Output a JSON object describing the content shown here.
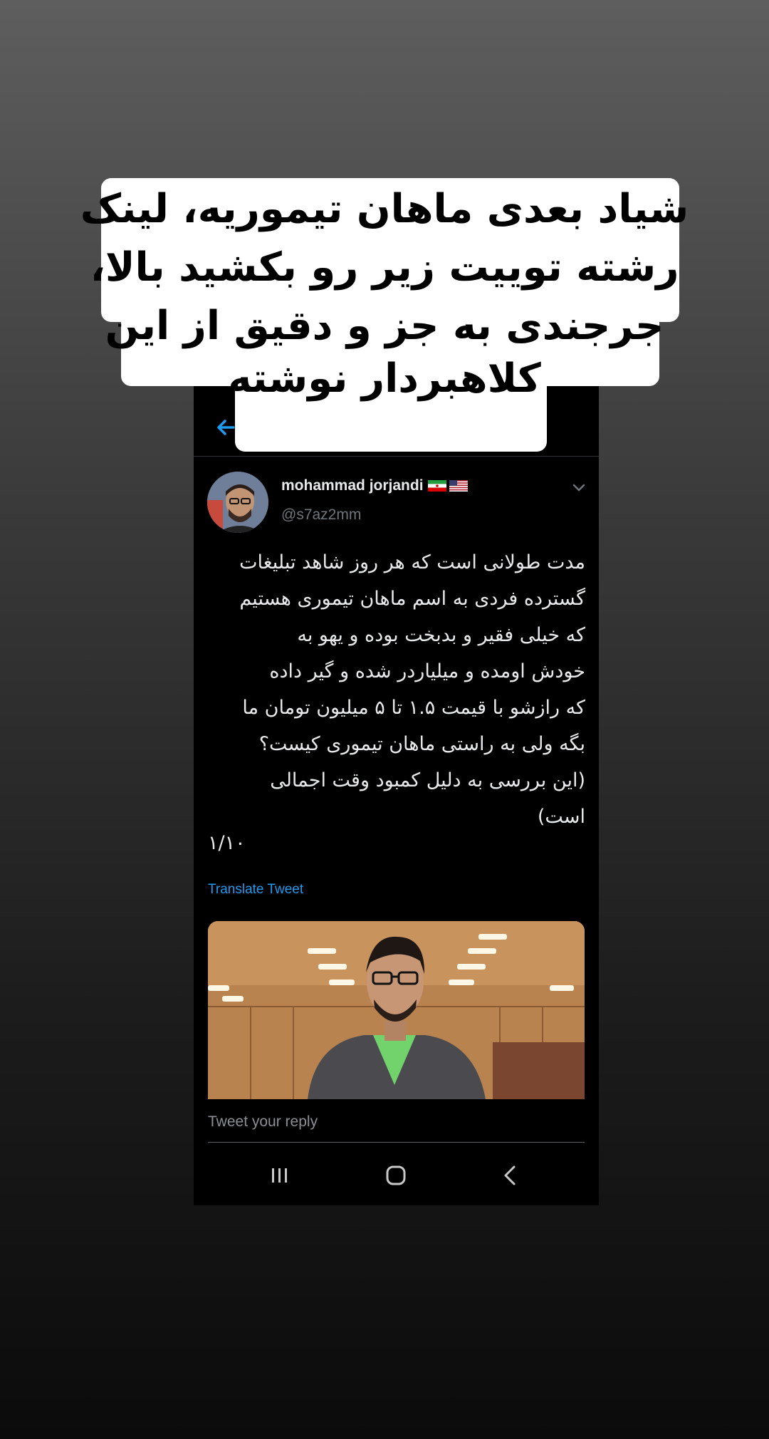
{
  "caption": {
    "lines": [
      "شیاد بعدی ماهان تیموریه، لینک",
      "رشته توییت زیر رو بکشید بالا،",
      "جرجندی به جز و دقیق از این",
      "کلاهبردار نوشته"
    ],
    "background_color": "#ffffff",
    "text_color": "#000000"
  },
  "tweet": {
    "author_name": "mohammad jorjandi",
    "author_flags": [
      "iran-flag-icon",
      "us-flag-icon"
    ],
    "handle": "@s7az2mm",
    "body_lines": [
      "مدت طولانی است که هر روز شاهد تبلیغات",
      "گسترده فردی به اسم ماهان تیموری هستیم",
      "که خیلی فقیر و بدبخت بوده و یهو به",
      "خودش اومده و میلیاردر شده و گیر داده",
      "که رازشو با قیمت ۱.۵ تا ۵ میلیون تومان ما",
      "بگه ولی به راستی ماهان تیموری کیست؟",
      "(این بررسی به دلیل کمبود وقت اجمالی",
      "است)"
    ],
    "thread_count": "۱/۱۰",
    "translate_label": "Translate Tweet"
  },
  "reply": {
    "placeholder": "Tweet your reply"
  },
  "navbar": {
    "items": [
      "recent-apps-icon",
      "home-icon",
      "back-icon"
    ]
  },
  "colors": {
    "accent": "#1d9bf0",
    "tweet_bg": "#000000",
    "text_primary": "#e7e9ea",
    "text_secondary": "#71767b"
  }
}
